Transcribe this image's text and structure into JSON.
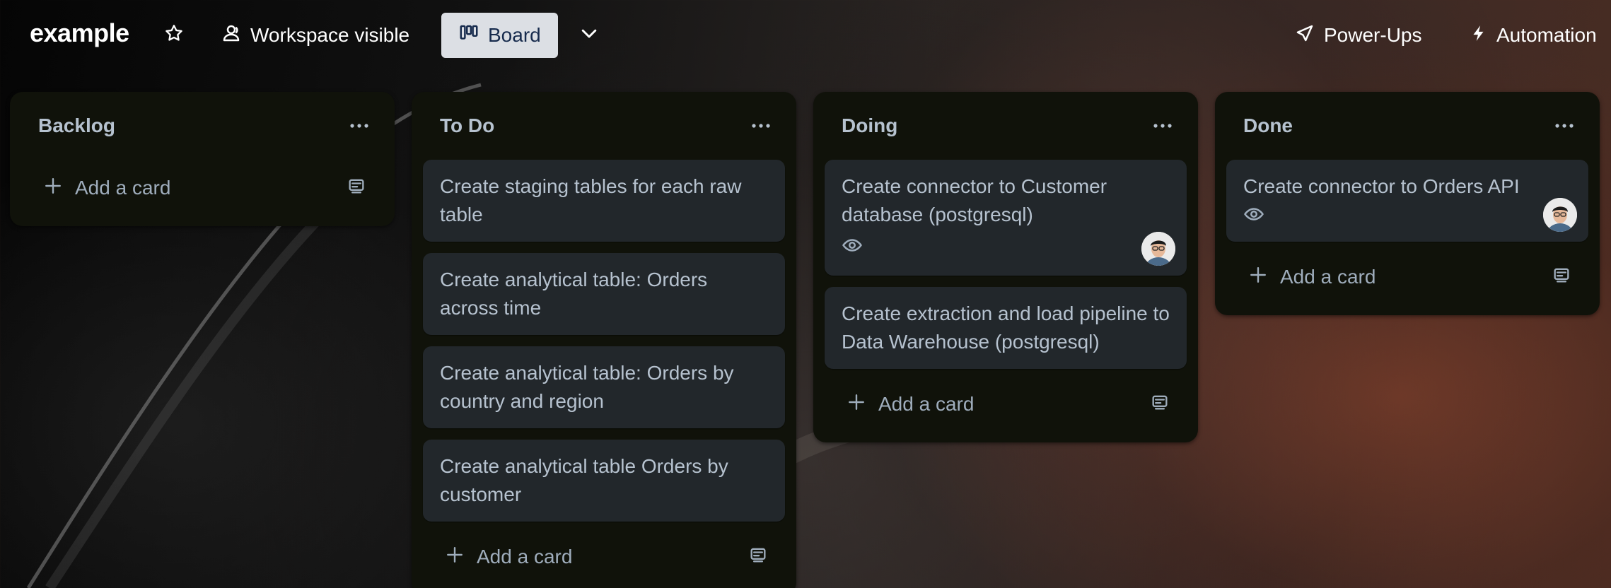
{
  "header": {
    "board_name": "example",
    "visibility_label": "Workspace visible",
    "view_label": "Board",
    "powerups_label": "Power-Ups",
    "automation_label": "Automation"
  },
  "lists": [
    {
      "title": "Backlog",
      "cards": [],
      "add_label": "Add a card"
    },
    {
      "title": "To Do",
      "cards": [
        {
          "title": "Create staging tables for each raw table"
        },
        {
          "title": "Create analytical table: Orders across time"
        },
        {
          "title": "Create analytical table: Orders by country and region"
        },
        {
          "title": "Create analytical table Orders by customer"
        }
      ],
      "add_label": "Add a card"
    },
    {
      "title": "Doing",
      "cards": [
        {
          "title": "Create connector to Customer database (postgresql)",
          "watched": true,
          "member": true
        },
        {
          "title": "Create extraction and load pipeline to Data Warehouse (postgresql)"
        }
      ],
      "add_label": "Add a card"
    },
    {
      "title": "Done",
      "cards": [
        {
          "title": "Create connector to Orders API",
          "watched": true,
          "member": true
        }
      ],
      "add_label": "Add a card"
    }
  ],
  "icons": {
    "star": "star-icon",
    "visibility": "people-icon",
    "view": "board-icon",
    "chevron": "chevron-down-icon",
    "powerups": "rocket-icon",
    "automation": "lightning-icon",
    "menu": "more-horizontal-icon",
    "add": "plus-icon",
    "template": "template-icon",
    "watch": "eye-icon"
  },
  "colors": {
    "list_bg": "#10120a",
    "card_bg": "#22272b",
    "view_button_bg": "#dcdfe4"
  }
}
